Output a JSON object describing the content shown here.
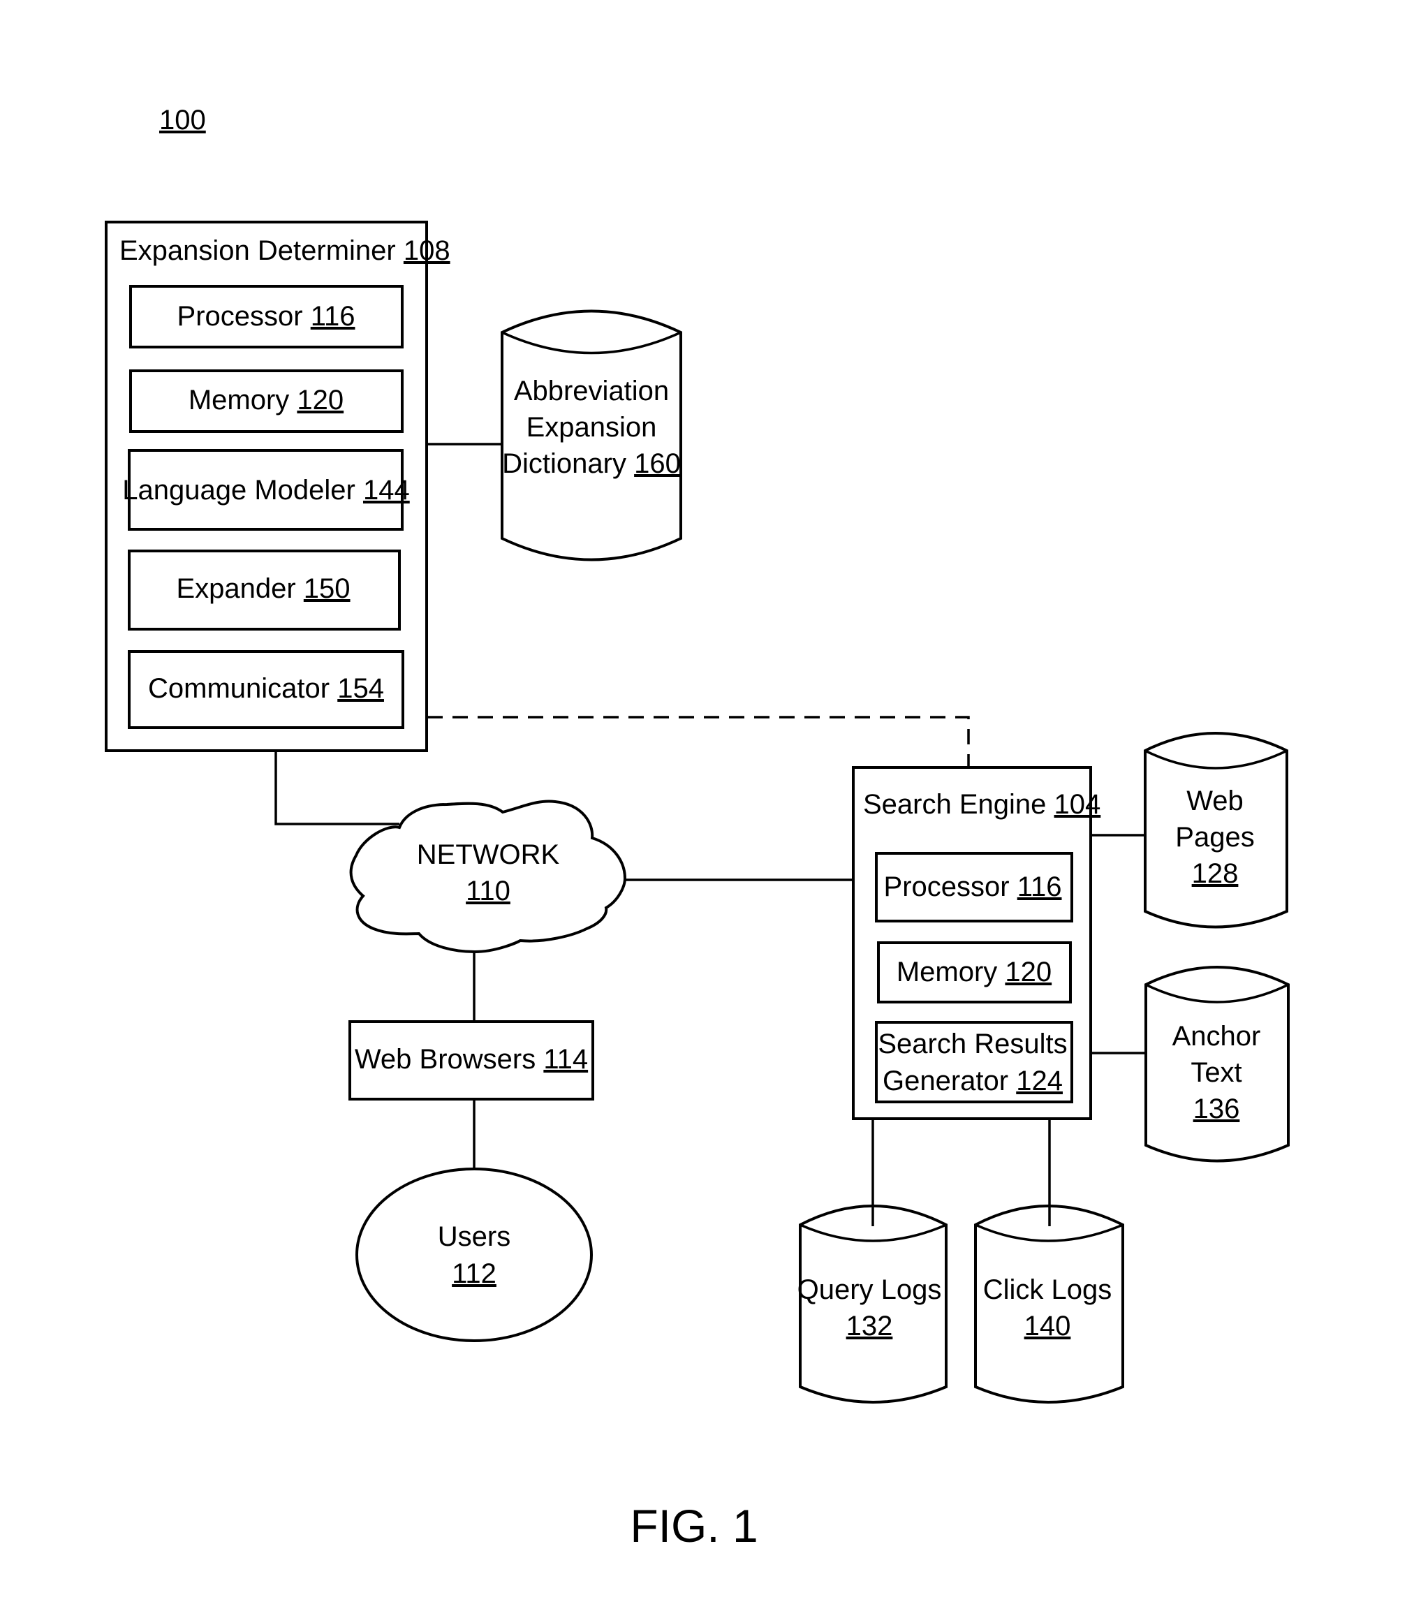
{
  "figure": {
    "reference_number": "100",
    "caption": "FIG. 1"
  },
  "expansion_determiner": {
    "title": "Expansion Determiner",
    "ref": "108",
    "components": [
      {
        "label": "Processor",
        "ref": "116"
      },
      {
        "label": "Memory",
        "ref": "120"
      },
      {
        "label": "Language Modeler",
        "ref": "144"
      },
      {
        "label": "Expander",
        "ref": "150"
      },
      {
        "label": "Communicator",
        "ref": "154"
      }
    ]
  },
  "dictionary": {
    "lines": [
      "Abbreviation",
      "Expansion",
      "Dictionary"
    ],
    "ref": "160"
  },
  "network": {
    "label": "NETWORK",
    "ref": "110"
  },
  "web_browsers": {
    "label": "Web Browsers",
    "ref": "114"
  },
  "users": {
    "label": "Users",
    "ref": "112"
  },
  "search_engine": {
    "title": "Search Engine",
    "ref": "104",
    "components": [
      {
        "label": "Processor",
        "ref": "116"
      },
      {
        "label": "Memory",
        "ref": "120"
      },
      {
        "label_lines": [
          "Search Results",
          "Generator"
        ],
        "ref": "124"
      }
    ]
  },
  "data_stores": {
    "web_pages": {
      "lines": [
        "Web",
        "Pages"
      ],
      "ref": "128"
    },
    "anchor_text": {
      "lines": [
        "Anchor",
        "Text"
      ],
      "ref": "136"
    },
    "query_logs": {
      "lines": [
        "Query Logs"
      ],
      "ref": "132"
    },
    "click_logs": {
      "lines": [
        "Click Logs"
      ],
      "ref": "140"
    }
  }
}
